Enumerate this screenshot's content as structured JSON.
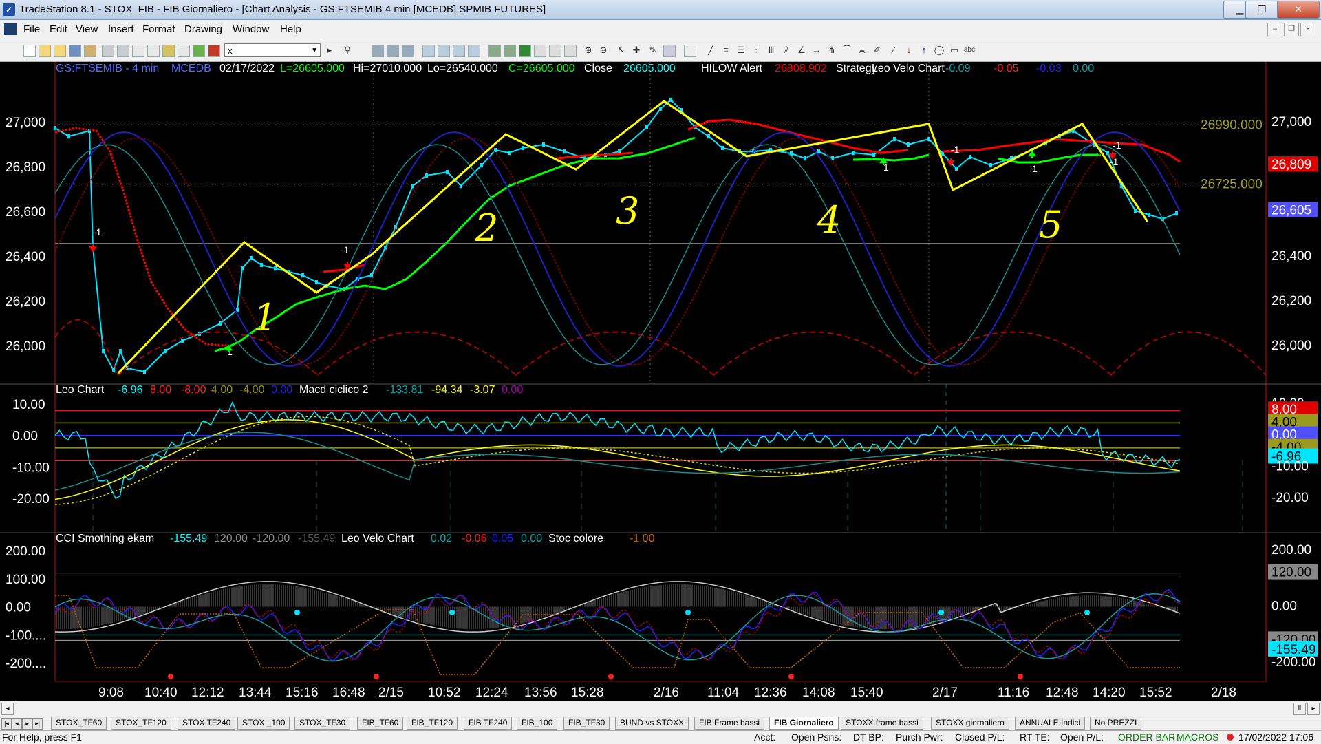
{
  "window": {
    "title": "TradeStation 8.1 - STOX_FIB - FIB Giornaliero - [Chart Analysis - GS:FTSEMIB  4 min  [MCEDB] SPMIB FUTURES]"
  },
  "menu": [
    "File",
    "Edit",
    "View",
    "Insert",
    "Format",
    "Drawing",
    "Window",
    "Help"
  ],
  "toolbar": {
    "symbol_value": "x"
  },
  "panel1": {
    "header": [
      {
        "text": "GS:FTSEMIB - 4 min",
        "color": "#4f6bff"
      },
      {
        "text": "MCEDB",
        "color": "#4f6bff"
      },
      {
        "text": "02/17/2022",
        "color": "#ffffff"
      },
      {
        "text": "L=26605.000",
        "color": "#00ff00"
      },
      {
        "text": "Hi=27010.000",
        "color": "#ffffff"
      },
      {
        "text": "Lo=26540.000",
        "color": "#ffffff"
      },
      {
        "text": "C=26605.000",
        "color": "#00ff00"
      },
      {
        "text": "Close",
        "color": "#ffffff"
      },
      {
        "text": "26605.000",
        "color": "#00ffff"
      },
      {
        "text": "HILOW Alert",
        "color": "#ffffff"
      },
      {
        "text": "26808.902",
        "color": "#ff0000"
      },
      {
        "text": "Strategy",
        "color": "#ffffff"
      },
      {
        "text": "Leo Velo Chart",
        "color": "#ffffff"
      },
      {
        "text": "-0.09",
        "color": "#00aaaa"
      },
      {
        "text": "-0.05",
        "color": "#ff2020"
      },
      {
        "text": "-0.03",
        "color": "#2020ff"
      },
      {
        "text": "0.00",
        "color": "#00aaaa"
      }
    ],
    "y_labels": [
      "27,000",
      "26,800",
      "26,600",
      "26,400",
      "26,200",
      "26,000"
    ],
    "right_labels": [
      {
        "text": "27,000",
        "kind": "plain"
      },
      {
        "text": "26,809",
        "kind": "red"
      },
      {
        "text": "26,605",
        "kind": "blue"
      },
      {
        "text": "26,400",
        "kind": "plain"
      },
      {
        "text": "26,200",
        "kind": "plain"
      },
      {
        "text": "26,000",
        "kind": "plain"
      }
    ],
    "level_labels": [
      "26990.000",
      "26725.000"
    ],
    "annotations": [
      "1",
      "2",
      "3",
      "4",
      "5"
    ],
    "signals": [
      "-1",
      "1",
      "-1",
      "-1",
      "1",
      "-1",
      "1",
      "-1"
    ]
  },
  "panel2": {
    "header": [
      {
        "text": "Leo Chart",
        "color": "#ffffff"
      },
      {
        "text": "-6.96",
        "color": "#00ffff"
      },
      {
        "text": "8.00",
        "color": "#ff2020"
      },
      {
        "text": "-8.00",
        "color": "#ff2020"
      },
      {
        "text": "4.00",
        "color": "#999900"
      },
      {
        "text": "-4.00",
        "color": "#999900"
      },
      {
        "text": "0.00",
        "color": "#2020ff"
      },
      {
        "text": "Macd ciclico 2",
        "color": "#ffffff"
      },
      {
        "text": "-133.81",
        "color": "#00aaaa"
      },
      {
        "text": "-94.34",
        "color": "#ffff00"
      },
      {
        "text": "-3.07",
        "color": "#ffff00"
      },
      {
        "text": "0.00",
        "color": "#aa00aa"
      }
    ],
    "y_labels": [
      "10.00",
      "0.00",
      "-10.00",
      "-20.00"
    ],
    "right_labels": [
      {
        "text": "10.00",
        "kind": "plain"
      },
      {
        "text": "8.00",
        "kind": "red"
      },
      {
        "text": "4.00",
        "kind": "olive"
      },
      {
        "text": "0.00",
        "kind": "blue"
      },
      {
        "text": "-4.00",
        "kind": "olive"
      },
      {
        "text": "-6.96",
        "kind": "cyan"
      },
      {
        "text": "-10.00",
        "kind": "plain"
      },
      {
        "text": "-20.00",
        "kind": "plain"
      }
    ]
  },
  "panel3": {
    "header": [
      {
        "text": "CCI Smothing ekam",
        "color": "#ffffff"
      },
      {
        "text": "-155.49",
        "color": "#00ffff"
      },
      {
        "text": "120.00",
        "color": "#888888"
      },
      {
        "text": "-120.00",
        "color": "#888888"
      },
      {
        "text": "-155.49",
        "color": "#555555"
      },
      {
        "text": "Leo Velo Chart",
        "color": "#ffffff"
      },
      {
        "text": "0.02",
        "color": "#00aaaa"
      },
      {
        "text": "-0.06",
        "color": "#ff2020"
      },
      {
        "text": "0.05",
        "color": "#2020ff"
      },
      {
        "text": "0.00",
        "color": "#00aaaa"
      },
      {
        "text": "Stoc colore",
        "color": "#ffffff"
      },
      {
        "text": "-1.00",
        "color": "#cc6600"
      }
    ],
    "y_labels": [
      "200.00",
      "100.00",
      "0.00",
      "-100....",
      "-200...."
    ],
    "right_labels": [
      {
        "text": "200.00",
        "kind": "plain"
      },
      {
        "text": "120.00",
        "kind": "grey"
      },
      {
        "text": "0.00",
        "kind": "plain"
      },
      {
        "text": "-120.00",
        "kind": "grey"
      },
      {
        "text": "-155.49",
        "kind": "cyan"
      },
      {
        "text": "-200.00",
        "kind": "plain"
      }
    ]
  },
  "x_labels": [
    "9:08",
    "10:40",
    "12:12",
    "13:44",
    "15:16",
    "16:48",
    "2/15",
    "10:52",
    "12:24",
    "13:56",
    "15:28",
    "2/16",
    "11:04",
    "12:36",
    "14:08",
    "15:40",
    "2/17",
    "11:16",
    "12:48",
    "14:20",
    "15:52",
    "2/18"
  ],
  "tabs": [
    "STOX_TF60",
    "STOX_TF120",
    "STOX TF240",
    "STOX _100",
    "STOX_TF30",
    "FIB_TF60",
    "FIB_TF120",
    "FIB TF240",
    "FIB_100",
    "FIB_TF30",
    "BUND vs STOXX",
    "FIB Frame bassi",
    "FIB Giornaliero",
    "STOXX frame bassi",
    "STOXX giornaliero",
    "ANNUALE Indici",
    "No PREZZI"
  ],
  "active_tab": "FIB Giornaliero",
  "status": {
    "help": "For Help, press F1",
    "acct": "Acct:",
    "open_psns": "Open Psns:",
    "dt_bp": "DT BP:",
    "purch_pwr": "Purch Pwr:",
    "closed_pl": "Closed P/L:",
    "rt_te": "RT TE:",
    "open_pl": "Open P/L:",
    "order_bar": "ORDER BAR",
    "macros": "MACROS",
    "datetime": "17/02/2022 17:06"
  },
  "colors": {
    "price": "#00e5ff",
    "zigzag": "#ffff00",
    "ma_red": "#ff0000",
    "ma_green": "#00ff00",
    "cycle": "#d00000"
  }
}
